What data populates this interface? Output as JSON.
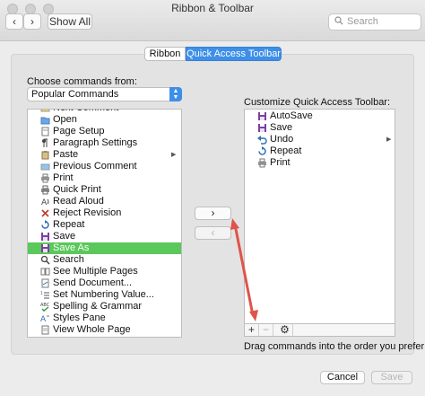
{
  "window": {
    "title": "Ribbon & Toolbar",
    "back_glyph": "‹",
    "forward_glyph": "›",
    "show_all_label": "Show All",
    "search_placeholder": "Search"
  },
  "tabs": [
    {
      "label": "Ribbon",
      "selected": false
    },
    {
      "label": "Quick Access Toolbar",
      "selected": true
    }
  ],
  "left": {
    "choose_label": "Choose commands from:",
    "source_value": "Popular Commands",
    "commands": [
      {
        "label": "Next Comment",
        "icon": "next-comment-icon"
      },
      {
        "label": "Open",
        "icon": "folder-icon"
      },
      {
        "label": "Page Setup",
        "icon": "page-setup-icon"
      },
      {
        "label": "Paragraph Settings",
        "icon": "paragraph-icon"
      },
      {
        "label": "Paste",
        "icon": "clipboard-icon",
        "submenu": true
      },
      {
        "label": "Previous Comment",
        "icon": "previous-comment-icon"
      },
      {
        "label": "Print",
        "icon": "printer-icon"
      },
      {
        "label": "Quick Print",
        "icon": "quick-print-icon"
      },
      {
        "label": "Read Aloud",
        "icon": "read-aloud-icon"
      },
      {
        "label": "Reject Revision",
        "icon": "reject-icon"
      },
      {
        "label": "Repeat",
        "icon": "repeat-icon"
      },
      {
        "label": "Save",
        "icon": "floppy-disk-icon"
      },
      {
        "label": "Save As",
        "icon": "save-as-icon",
        "selected": true
      },
      {
        "label": "Search",
        "icon": "magnifier-icon"
      },
      {
        "label": "See Multiple Pages",
        "icon": "multiple-pages-icon"
      },
      {
        "label": "Send Document...",
        "icon": "send-document-icon"
      },
      {
        "label": "Set Numbering Value...",
        "icon": "numbering-icon"
      },
      {
        "label": "Spelling & Grammar",
        "icon": "spelling-icon"
      },
      {
        "label": "Styles Pane",
        "icon": "styles-pane-icon"
      },
      {
        "label": "View Whole Page",
        "icon": "whole-page-icon"
      }
    ]
  },
  "move": {
    "add_glyph": "›",
    "remove_glyph": "‹"
  },
  "right": {
    "customize_label": "Customize Quick Access Toolbar:",
    "items": [
      {
        "label": "AutoSave",
        "icon": "autosave-icon"
      },
      {
        "label": "Save",
        "icon": "floppy-disk-icon"
      },
      {
        "label": "Undo",
        "icon": "undo-icon",
        "submenu": true
      },
      {
        "label": "Repeat",
        "icon": "repeat-icon"
      },
      {
        "label": "Print",
        "icon": "printer-icon"
      }
    ],
    "add_glyph": "+",
    "remove_glyph": "−",
    "settings_glyph": "⚙",
    "hint": "Drag commands into the order you prefer"
  },
  "footer": {
    "cancel_label": "Cancel",
    "save_label": "Save"
  },
  "colors": {
    "accent": "#3d8fe8",
    "selection": "#5ac85a",
    "annotation_arrow": "#e0534a",
    "save_purple": "#7c3fa0"
  }
}
